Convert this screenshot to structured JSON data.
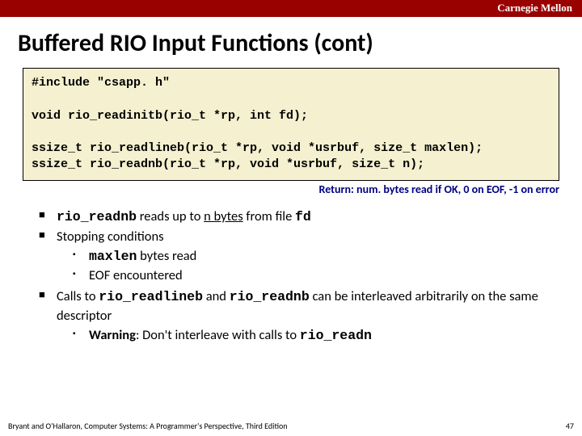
{
  "header": {
    "org": "Carnegie Mellon"
  },
  "title": "Buffered RIO Input Functions (cont)",
  "code": "#include \"csapp. h\"\n\nvoid rio_readinitb(rio_t *rp, int fd);\n\nssize_t rio_readlineb(rio_t *rp, void *usrbuf, size_t maxlen);\nssize_t rio_readnb(rio_t *rp, void *usrbuf, size_t n);",
  "return_note": "Return: num. bytes read if OK, 0 on EOF, -1 on error",
  "bullets": {
    "b1_pre": "rio_readnb",
    "b1_mid": " reads up to ",
    "b1_n": "n bytes",
    "b1_post": " from file ",
    "b1_fd": "fd",
    "b2": "Stopping conditions",
    "b2a_pre": "maxlen",
    "b2a_post": " bytes read",
    "b2b": "EOF encountered",
    "b3_pre": "Calls to ",
    "b3_f1": "rio_readlineb",
    "b3_mid": " and ",
    "b3_f2": "rio_readnb",
    "b3_post": " can be interleaved arbitrarily on the same descriptor",
    "b3a_warn": "Warning",
    "b3a_mid": ": Don't interleave with calls to ",
    "b3a_fn": "rio_readn"
  },
  "footer": {
    "left": "Bryant and O'Hallaron, Computer Systems: A Programmer's Perspective, Third Edition",
    "right": "47"
  }
}
